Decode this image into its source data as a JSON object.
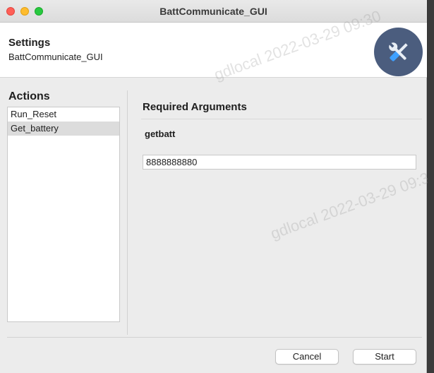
{
  "window": {
    "title": "BattCommunicate_GUI"
  },
  "header": {
    "title": "Settings",
    "subtitle": "BattCommunicate_GUI",
    "icon": "tools-icon",
    "icon_bg": "#4b5d7e"
  },
  "actions": {
    "title": "Actions",
    "items": [
      {
        "label": "Run_Reset",
        "selected": false
      },
      {
        "label": "Get_battery",
        "selected": true
      }
    ]
  },
  "arguments": {
    "title": "Required Arguments",
    "field_label": "getbatt",
    "field_value": "8888888880"
  },
  "buttons": {
    "cancel": "Cancel",
    "start": "Start"
  },
  "watermark": "gdlocal 2022-03-29 09:30"
}
